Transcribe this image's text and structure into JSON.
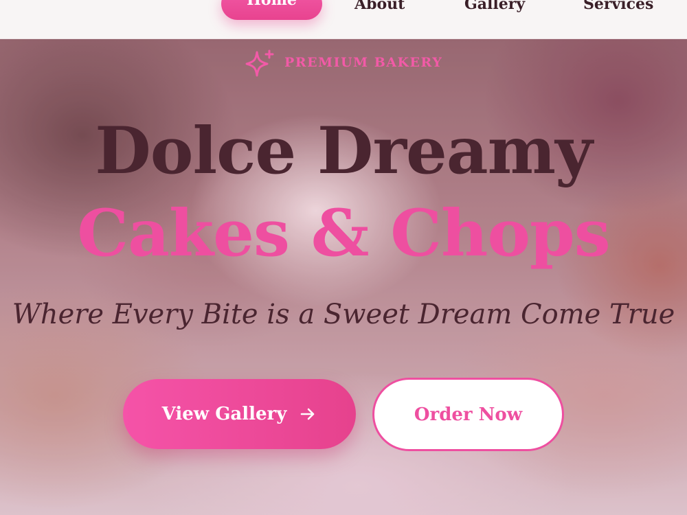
{
  "nav": {
    "items": [
      {
        "label": "Home",
        "active": true
      },
      {
        "label": "About"
      },
      {
        "label": "Gallery"
      },
      {
        "label": "Services"
      }
    ]
  },
  "hero": {
    "badge": {
      "icon": "sparkle-icon",
      "text": "PREMIUM BAKERY"
    },
    "title_line1": "Dolce Dreamy",
    "title_line2": "Cakes & Chops",
    "tagline": "Where Every Bite is a Sweet Dream Come True",
    "primary_button": {
      "label": "View Gallery",
      "icon": "arrow-right-icon"
    },
    "secondary_button": {
      "label": "Order Now"
    }
  },
  "colors": {
    "accent_pink": "#ee4fa0",
    "title_dark": "#4a2530",
    "nav_bg": "#f8f5f5"
  }
}
